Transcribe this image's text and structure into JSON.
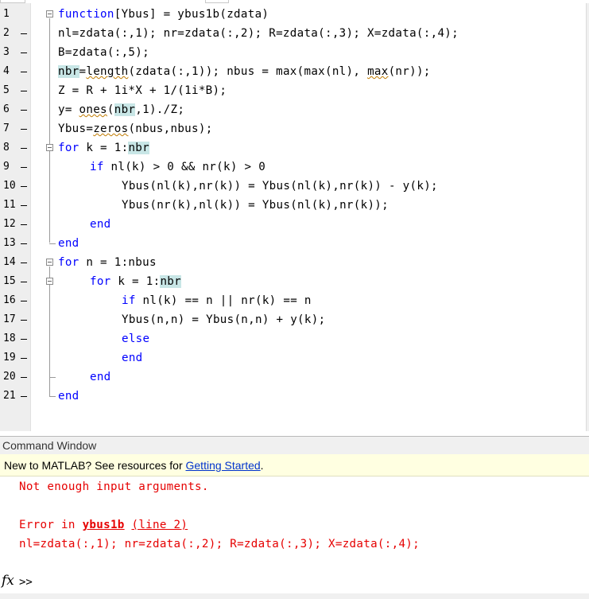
{
  "editor": {
    "line_numbers": [
      "1",
      "2",
      "3",
      "4",
      "5",
      "6",
      "7",
      "8",
      "9",
      "10",
      "11",
      "12",
      "13",
      "14",
      "15",
      "16",
      "17",
      "18",
      "19",
      "20",
      "21"
    ],
    "line2": {
      "a": "nl=zdata(:,1); nr=zdata(:,2); R=zdata(:,3); X=zdata(:,4);"
    },
    "line3": {
      "a": "B=zdata(:,5);"
    },
    "line4": {
      "a": "nbr",
      "b": "=",
      "c": "length",
      "d": "(zdata(:,1)); nbus = max(max(nl), ",
      "e": "max",
      "f": "(nr));"
    },
    "line5": {
      "a": "Z = R + 1i*X + 1/(1i*B);"
    },
    "line6": {
      "a": "y= ",
      "b": "ones",
      "c": "(",
      "d": "nbr",
      "e": ",1)./Z;"
    },
    "line7": {
      "a": "Ybus=",
      "b": "zeros",
      "c": "(nbus,nbus);"
    },
    "line1": {
      "kw": "function",
      "a": "[Ybus] = ybus1b(zdata)"
    },
    "line8": {
      "kw": "for",
      "a": " k = 1:",
      "b": "nbr"
    },
    "line9": {
      "kw": "if",
      "a": " nl(k) > 0 && nr(k) > 0"
    },
    "line10": {
      "a": "Ybus(nl(k),nr(k)) = Ybus(nl(k),nr(k)) - y(k);"
    },
    "line11": {
      "a": "Ybus(nr(k),nl(k)) = Ybus(nl(k),nr(k));"
    },
    "line12": {
      "kw": "end"
    },
    "line13": {
      "kw": "end"
    },
    "line14": {
      "kw": "for",
      "a": " n = 1:nbus"
    },
    "line15": {
      "kw": "for",
      "a": " k = 1:",
      "b": "nbr"
    },
    "line16": {
      "kw": "if",
      "a": " nl(k) == n || nr(k) == n"
    },
    "line17": {
      "a": "Ybus(n,n) = Ybus(n,n) + y(k);"
    },
    "line18": {
      "kw": "else"
    },
    "line19": {
      "kw": "end"
    },
    "line20": {
      "kw": "end"
    },
    "line21": {
      "kw": "end"
    }
  },
  "command_window": {
    "title": "Command Window",
    "banner_text": "New to MATLAB? See resources for ",
    "banner_link": "Getting Started",
    "banner_period": ".",
    "error1": "Not enough input arguments.",
    "error_prefix": "Error in ",
    "error_func": "ybus1b",
    "error_line": "(line 2)",
    "error_code": "nl=zdata(:,1); nr=zdata(:,2); R=zdata(:,3); X=zdata(:,4);",
    "fx_symbol": "fx",
    "prompt": ">>"
  },
  "colors": {
    "keyword": "#0000ff",
    "error": "#e60000",
    "highlight": "#c8e6e6",
    "banner_bg": "#ffffe1"
  }
}
